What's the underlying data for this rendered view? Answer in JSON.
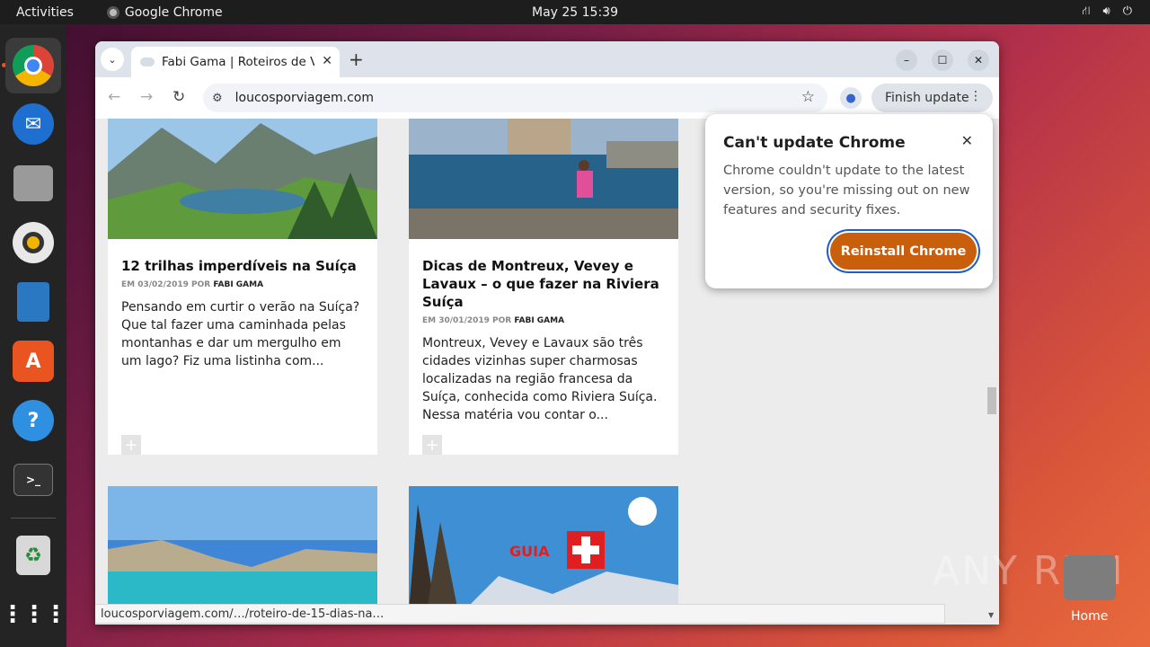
{
  "topbar": {
    "activities": "Activities",
    "app_name": "Google Chrome",
    "clock": "May 25  15:39",
    "tray": [
      "network-icon",
      "volume-icon",
      "power-icon"
    ]
  },
  "dock": {
    "items": [
      "chrome",
      "thunderbird",
      "files",
      "rhythmbox",
      "writer",
      "app-center",
      "help",
      "terminal",
      "trash",
      "show-apps"
    ]
  },
  "browser": {
    "tab_title": "Fabi Gama | Roteiros de Viagem",
    "url": "loucosporviagem.com",
    "finish_update": "Finish update",
    "status_url": "loucosporviagem.com/…/roteiro-de-15-dias-na…"
  },
  "cards": [
    {
      "title": "12 trilhas imperdíveis na Suíça",
      "meta_prefix": "EM 03/02/2019 POR",
      "author": "FABI GAMA",
      "excerpt": "Pensando em curtir o verão na Suíça? Que tal fazer uma caminhada pelas montanhas e dar um mergulho em um lago? Fiz uma listinha com..."
    },
    {
      "title": "Dicas de Montreux, Vevey e Lavaux – o que fazer na Riviera Suíça",
      "meta_prefix": "EM 30/01/2019 POR",
      "author": "FABI GAMA",
      "excerpt": "Montreux, Vevey e Lavaux são três cidades vizinhas super charmosas localizadas na região francesa da Suíça, conhecida como Riviera Suíça. Nessa matéria vou contar o..."
    },
    {
      "image_text": "GUIA"
    }
  ],
  "popup": {
    "title": "Can't update Chrome",
    "body": "Chrome couldn't update to the latest version, so you're missing out on new features and security fixes.",
    "button": "Reinstall Chrome"
  },
  "desktop": {
    "home_label": "Home",
    "watermark": "ANY RUN"
  },
  "colors": {
    "accent": "#c95e0c",
    "focus_ring": "#1b5fc4",
    "ubuntu_orange": "#e95420"
  }
}
